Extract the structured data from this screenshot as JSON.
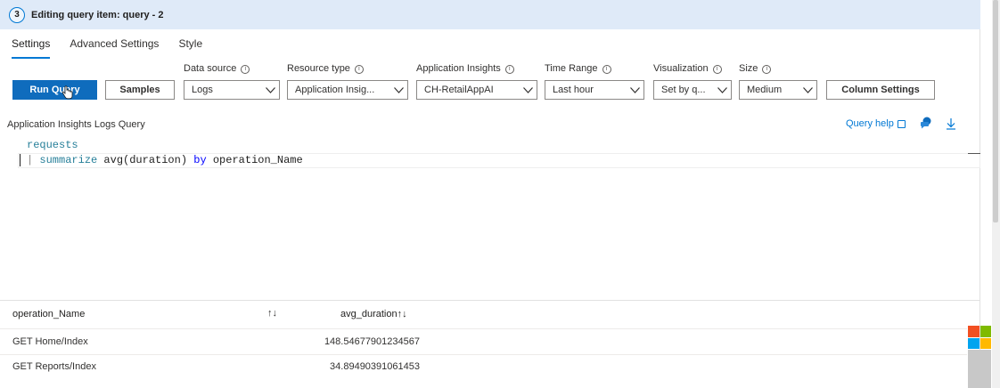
{
  "header": {
    "step_number": "3",
    "title": "Editing query item: query - 2"
  },
  "tabs": [
    {
      "label": "Settings",
      "active": true
    },
    {
      "label": "Advanced Settings",
      "active": false
    },
    {
      "label": "Style",
      "active": false
    }
  ],
  "toolbar": {
    "run_query_label": "Run Query",
    "samples_label": "Samples",
    "column_settings_label": "Column Settings",
    "info_glyph": "i",
    "fields": {
      "data_source": {
        "label": "Data source",
        "value": "Logs"
      },
      "resource_type": {
        "label": "Resource type",
        "value": "Application Insig..."
      },
      "app_insights": {
        "label": "Application Insights",
        "value": "CH-RetailAppAI"
      },
      "time_range": {
        "label": "Time Range",
        "value": "Last hour"
      },
      "visualization": {
        "label": "Visualization",
        "value": "Set by q..."
      },
      "size": {
        "label": "Size",
        "value": "Medium"
      }
    }
  },
  "query": {
    "section_label": "Application Insights Logs Query",
    "help_link": "Query help",
    "lines": {
      "line1": "requests",
      "line2_pipe": "| ",
      "line2_kw": "summarize",
      "line2_fn": " avg(duration) ",
      "line2_by": "by",
      "line2_rest": " operation_Name"
    }
  },
  "results": {
    "columns": [
      {
        "label": "operation_Name",
        "sort": "↑↓"
      },
      {
        "label": "avg_duration",
        "sort": "↑↓"
      }
    ],
    "rows": [
      {
        "operation_Name": "GET Home/Index",
        "avg_duration": "148.54677901234567"
      },
      {
        "operation_Name": "GET Reports/Index",
        "avg_duration": "34.89490391061453"
      }
    ]
  },
  "colors": {
    "accent": "#0f6cbd",
    "header_bg": "#dfeaf8",
    "link": "#0078d4"
  },
  "icons": {
    "run_cursor": "hand-cursor-icon",
    "chevron": "chevron-down-icon",
    "external": "external-link-icon",
    "chat": "chat-feedback-icon",
    "download": "download-icon",
    "info": "info-icon",
    "logo": "microsoft-logo-icon"
  }
}
